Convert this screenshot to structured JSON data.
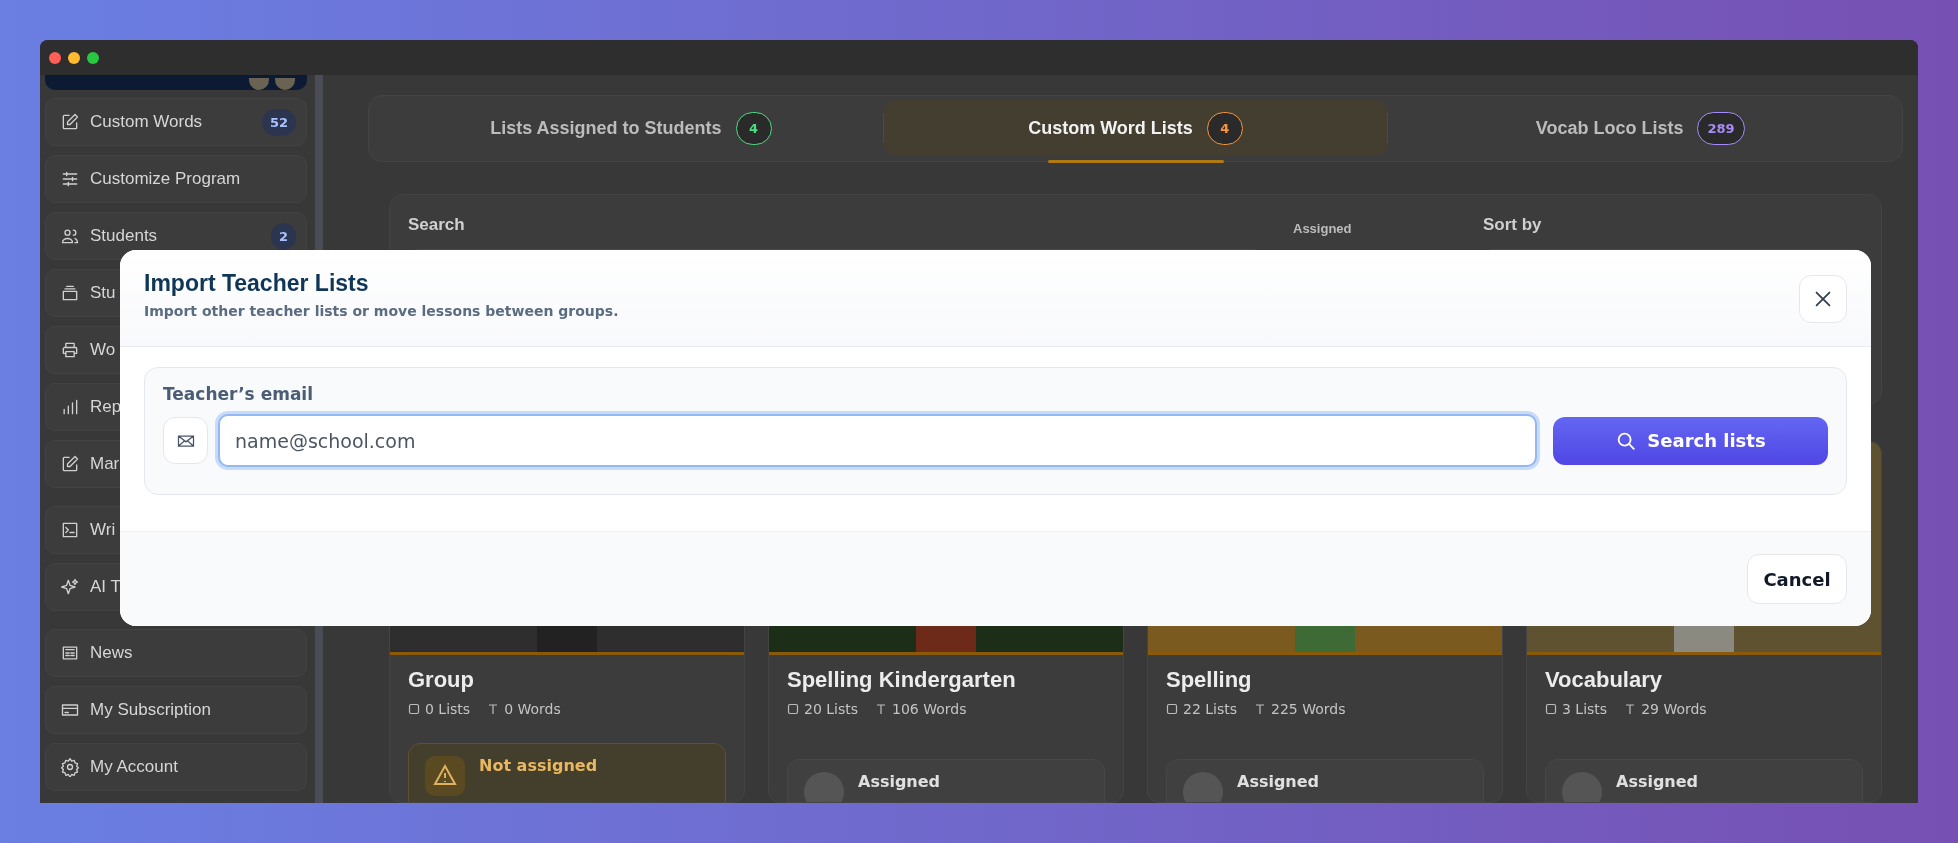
{
  "sidebar": {
    "groups": [
      {
        "items": [
          {
            "label": "Custom Words",
            "badge": "52"
          },
          {
            "label": "Customize Program"
          },
          {
            "label": "Students",
            "badge": "2"
          },
          {
            "label": "Stu"
          },
          {
            "label": "Wo"
          },
          {
            "label": "Rep"
          },
          {
            "label": "Mar"
          }
        ]
      },
      {
        "items": [
          {
            "label": "Wri"
          },
          {
            "label": "AI T"
          }
        ]
      },
      {
        "items": [
          {
            "label": "News"
          },
          {
            "label": "My Subscription"
          },
          {
            "label": "My Account"
          }
        ]
      }
    ]
  },
  "tabs": [
    {
      "label": "Lists Assigned to Students",
      "count": "4",
      "color": "#4ade80",
      "selected": false
    },
    {
      "label": "Custom Word Lists",
      "count": "4",
      "color": "#fb923c",
      "selected": true
    },
    {
      "label": "Vocab Loco Lists",
      "count": "289",
      "color": "#a78bfa",
      "selected": false
    }
  ],
  "filters": {
    "search_label": "Search",
    "assigned_label": "Assigned",
    "sort_label": "Sort by"
  },
  "cards": [
    {
      "title": "Group",
      "lists": "0 Lists",
      "words": "0 Words",
      "status": {
        "kind": "not_assigned",
        "label": "Not assigned"
      }
    },
    {
      "title": "Spelling Kindergarten",
      "lists": "20 Lists",
      "words": "106 Words",
      "status": {
        "kind": "assigned",
        "label": "Assigned"
      }
    },
    {
      "title": "Spelling",
      "lists": "22 Lists",
      "words": "225 Words",
      "status": {
        "kind": "assigned",
        "label": "Assigned"
      }
    },
    {
      "title": "Vocabulary",
      "lists": "3 Lists",
      "words": "29 Words",
      "status": {
        "kind": "assigned",
        "label": "Assigned"
      }
    }
  ],
  "modal": {
    "title": "Import Teacher Lists",
    "subtitle": "Import other teacher lists or move lessons between groups.",
    "field_label": "Teacher’s email",
    "placeholder": "name@school.com",
    "search_button": "Search lists",
    "cancel_button": "Cancel"
  }
}
